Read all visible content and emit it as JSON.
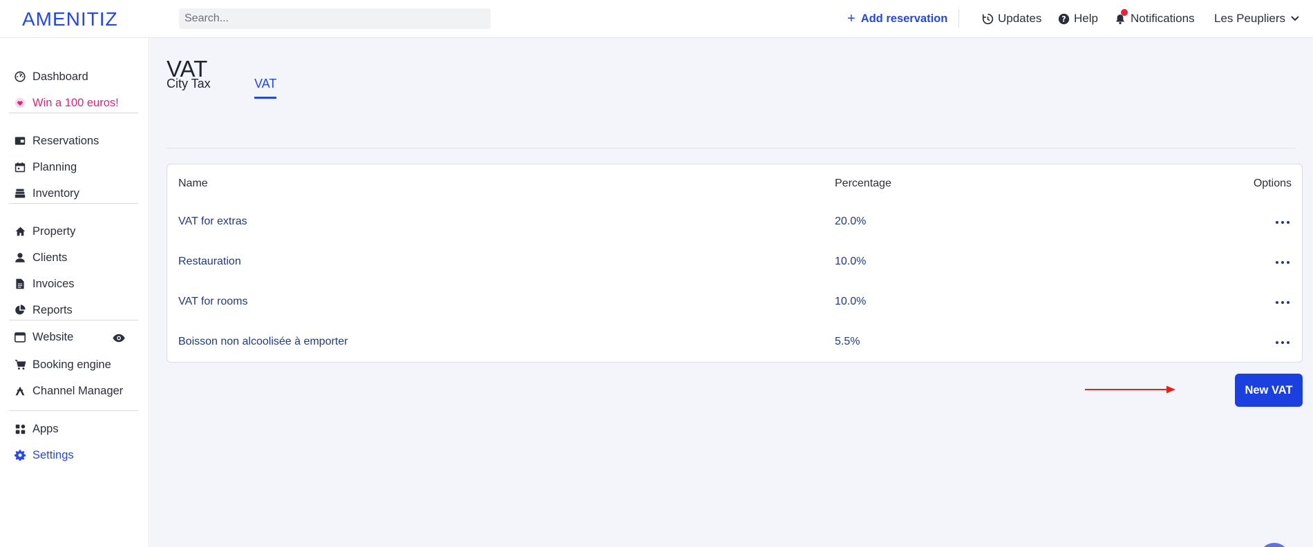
{
  "app": {
    "logo_text": "AMENITIZ",
    "brand_color": "#2347e8"
  },
  "topbar": {
    "search_placeholder": "Search...",
    "add_reservation": "Add reservation",
    "updates": "Updates",
    "help": "Help",
    "notifications": "Notifications",
    "notification_badge_color": "#e0243a",
    "property_name": "Les Peupliers"
  },
  "sidebar": {
    "items": [
      {
        "label": "Dashboard",
        "icon": "dashboard-icon"
      },
      {
        "label": "Win a 100 euros!",
        "icon": "heart-icon",
        "color": "#e0217d"
      },
      {
        "label": "Reservations",
        "icon": "reservations-icon"
      },
      {
        "label": "Planning",
        "icon": "calendar-icon"
      },
      {
        "label": "Inventory",
        "icon": "inventory-icon"
      },
      {
        "label": "Property",
        "icon": "home-icon"
      },
      {
        "label": "Clients",
        "icon": "user-icon"
      },
      {
        "label": "Invoices",
        "icon": "file-icon"
      },
      {
        "label": "Reports",
        "icon": "pie-chart-icon"
      },
      {
        "label": "Website",
        "icon": "browser-icon"
      },
      {
        "label": "Booking engine",
        "icon": "cart-icon"
      },
      {
        "label": "Channel Manager",
        "icon": "channel-icon"
      },
      {
        "label": "Apps",
        "icon": "apps-icon"
      },
      {
        "label": "Settings",
        "icon": "gear-icon",
        "active": true
      }
    ]
  },
  "page": {
    "title": "VAT",
    "tabs": [
      {
        "label": "City Tax",
        "active": false
      },
      {
        "label": "VAT",
        "active": true
      }
    ]
  },
  "table": {
    "headers": {
      "name": "Name",
      "percentage": "Percentage",
      "options": "Options"
    },
    "rows": [
      {
        "name": "VAT for extras",
        "percentage": "20.0%"
      },
      {
        "name": "Restauration",
        "percentage": "10.0%"
      },
      {
        "name": "VAT for rooms",
        "percentage": "10.0%"
      },
      {
        "name": "Boisson non alcoolisée à emporter",
        "percentage": "5.5%"
      }
    ]
  },
  "actions": {
    "new_vat": "New VAT",
    "button_color": "#1c3fe0",
    "annotation_arrow_color": "#e0241a"
  }
}
